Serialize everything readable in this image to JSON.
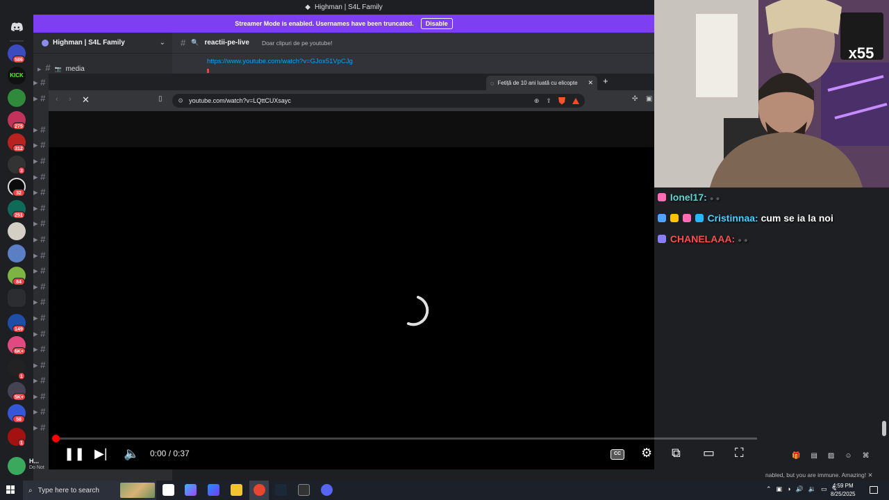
{
  "discord": {
    "window_title": "Highman | S4L Family",
    "banner_text": "Streamer Mode is enabled. Usernames have been truncated.",
    "banner_button": "Disable",
    "server_name": "Highman | S4L Family",
    "channel_name": "reactii-pe-live",
    "channel_topic": "Doar clipuri de pe youtube!",
    "sidebar_channel": "media",
    "message_link": "https://www.youtube.com/watch?v=GJox51VpCJg",
    "badges": [
      "586",
      "275",
      "312",
      "3",
      "32",
      "251",
      "84",
      "149",
      "6K+",
      "1",
      "5K+",
      "58",
      "1"
    ],
    "user": {
      "name": "H...",
      "status": "Do Not"
    },
    "kick_label": "KICK"
  },
  "browser": {
    "tab_title": "Fetiță de 10 ani luată cu elicopte",
    "url": "youtube.com/watch?v=LQttCUXsayc"
  },
  "player": {
    "time": "0:00 / 0:37",
    "progress": 0.0,
    "cc_label": "CC"
  },
  "stream_overlay": {
    "sub_count": "x55",
    "chat": [
      {
        "user": "Ionel17:",
        "color": "#5fd4d4",
        "message": ""
      },
      {
        "user": "Cristinnaa:",
        "color": "#4dd0ff",
        "message": "cum se ia la noi"
      },
      {
        "user": "CHANELAAA:",
        "color": "#ff4d4d",
        "message": ""
      }
    ],
    "immune_text": "nabled, but you are immune. Amazing!"
  },
  "taskbar": {
    "search_placeholder": "Type here to search",
    "clock_time": "4:59 PM",
    "clock_date": "8/25/2025"
  }
}
